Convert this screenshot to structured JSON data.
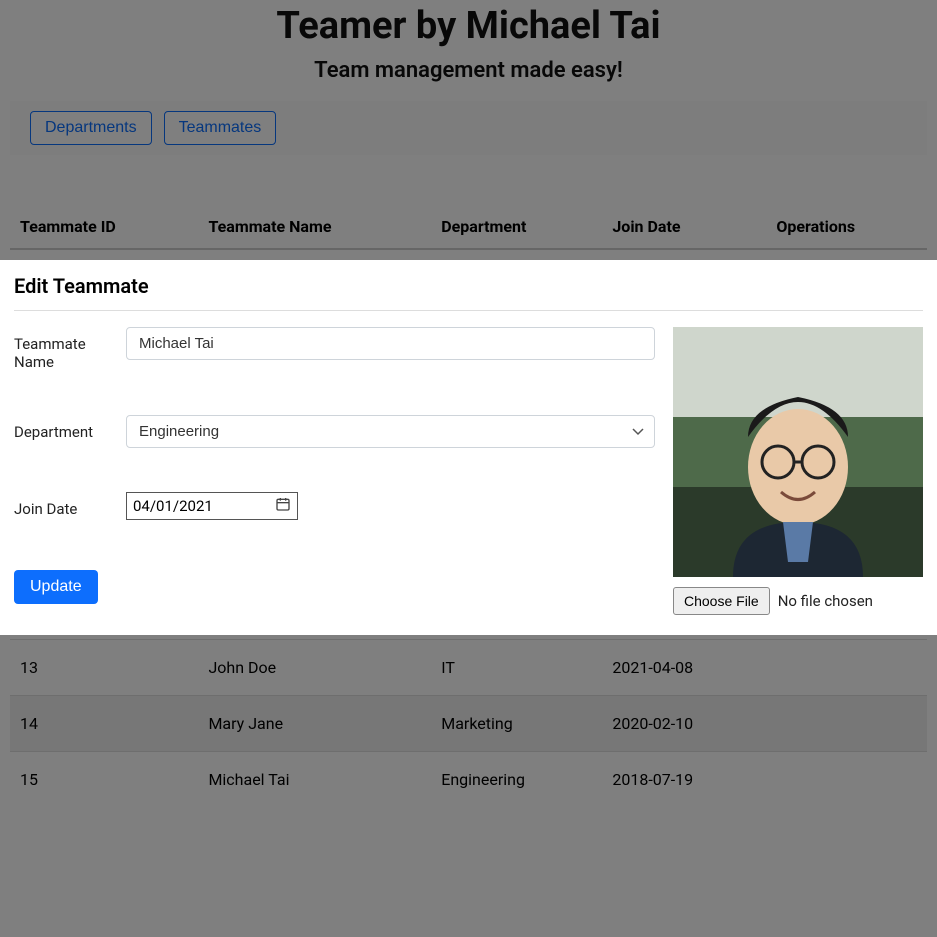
{
  "header": {
    "title": "Teamer by Michael Tai",
    "subtitle": "Team management made easy!"
  },
  "nav": {
    "departments": "Departments",
    "teammates": "Teammates"
  },
  "table": {
    "cols": {
      "id": "Teammate ID",
      "name": "Teammate Name",
      "dept": "Department",
      "join": "Join Date",
      "ops": "Operations"
    },
    "rows": [
      {
        "id": "13",
        "name": "John Doe",
        "dept": "IT",
        "join": "2021-04-08"
      },
      {
        "id": "14",
        "name": "Mary Jane",
        "dept": "Marketing",
        "join": "2020-02-10"
      },
      {
        "id": "15",
        "name": "Michael Tai",
        "dept": "Engineering",
        "join": "2018-07-19"
      }
    ]
  },
  "modal": {
    "title": "Edit Teammate",
    "labels": {
      "name": "Teammate Name",
      "dept": "Department",
      "join": "Join Date"
    },
    "values": {
      "name": "Michael Tai",
      "dept": "Engineering",
      "join": "04/01/2021"
    },
    "file": {
      "button": "Choose File",
      "status": "No file chosen"
    },
    "update": "Update"
  }
}
